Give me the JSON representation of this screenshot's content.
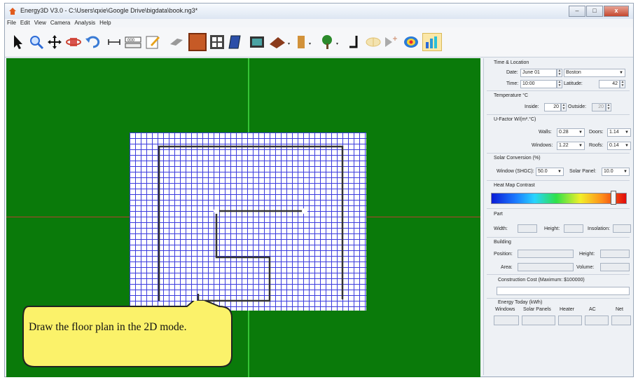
{
  "window": {
    "title": "Energy3D V3.0 - C:\\Users\\qxie\\Google Drive\\bigdata\\book.ng3*",
    "minimize": "–",
    "maximize": "□",
    "close": "x"
  },
  "menu": [
    "File",
    "Edit",
    "View",
    "Camera",
    "Analysis",
    "Help"
  ],
  "toolbar_icons": [
    "select-arrow-icon",
    "zoom-icon",
    "move-icon",
    "rotate-icon",
    "undo-icon",
    "measure-icon",
    "note-icon",
    "annotate-icon",
    "eraser-icon",
    "wall-icon",
    "window-icon",
    "solar-panel-icon",
    "floor-icon",
    "roof-icon",
    "door-icon",
    "tree-icon",
    "person-icon",
    "sun-icon",
    "play-icon",
    "heatmap-icon",
    "chart-icon"
  ],
  "callout": {
    "text": "Draw the floor plan in the 2D mode."
  },
  "panel": {
    "time_location": {
      "section": "Time & Location",
      "date_label": "Date:",
      "date_value": "June 01",
      "city_value": "Boston",
      "time_label": "Time:",
      "time_value": "10:00",
      "latitude_label": "Latitude:",
      "latitude_value": "42"
    },
    "temperature": {
      "section": "Temperature °C",
      "inside_label": "Inside:",
      "inside_value": "20",
      "outside_label": "Outside:",
      "outside_value": "20"
    },
    "ufactor": {
      "section": "U-Factor W/(m².°C)",
      "walls_label": "Walls:",
      "walls_value": "0.28",
      "doors_label": "Doors:",
      "doors_value": "1.14",
      "windows_label": "Windows:",
      "windows_value": "1.22",
      "roofs_label": "Roofs:",
      "roofs_value": "0.14"
    },
    "solar": {
      "section": "Solar Conversion (%)",
      "window_label": "Window (SHGC):",
      "window_value": "50.0",
      "panel_label": "Solar Panel:",
      "panel_value": "10.0"
    },
    "heatmap": {
      "section": "Heat Map Contrast",
      "level": 0.9
    },
    "part": {
      "section": "Part",
      "width_label": "Width:",
      "height_label": "Height:",
      "insolation_label": "Insolation:"
    },
    "building": {
      "section": "Building",
      "position_label": "Position:",
      "height_label": "Height:",
      "area_label": "Area:",
      "volume_label": "Volume:"
    },
    "construction": {
      "section": "Construction Cost (Maximum: $100000)"
    },
    "energy": {
      "section": "Energy Today (kWh)",
      "columns": [
        "Windows",
        "Solar Panels",
        "Heater",
        "AC",
        "Net"
      ]
    }
  }
}
